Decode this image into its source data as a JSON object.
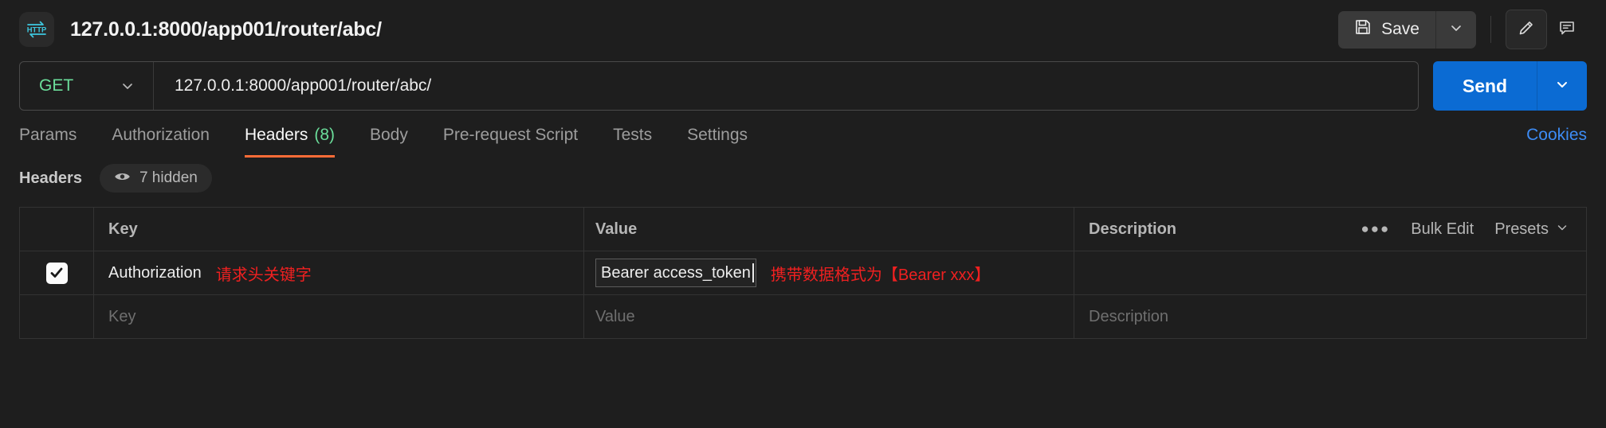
{
  "topbar": {
    "icon": "http-protocol-icon",
    "request_title": "127.0.0.1:8000/app001/router/abc/",
    "save_label": "Save",
    "save_icon": "floppy-disk-icon",
    "save_caret_icon": "chevron-down-icon",
    "edit_icon": "pencil-icon",
    "comment_icon": "comment-icon"
  },
  "url_row": {
    "method": "GET",
    "method_caret_icon": "chevron-down-icon",
    "url": "127.0.0.1:8000/app001/router/abc/",
    "send_label": "Send",
    "send_caret_icon": "chevron-down-icon"
  },
  "tabs": [
    {
      "label": "Params",
      "count": "",
      "active": false
    },
    {
      "label": "Authorization",
      "count": "",
      "active": false
    },
    {
      "label": "Headers",
      "count": "(8)",
      "active": true
    },
    {
      "label": "Body",
      "count": "",
      "active": false
    },
    {
      "label": "Pre-request Script",
      "count": "",
      "active": false
    },
    {
      "label": "Tests",
      "count": "",
      "active": false
    },
    {
      "label": "Settings",
      "count": "",
      "active": false
    }
  ],
  "cookies_label": "Cookies",
  "subbar": {
    "title": "Headers",
    "hidden_label": "7 hidden",
    "eye_icon": "eye-icon"
  },
  "table": {
    "columns": {
      "key": "Key",
      "value": "Value",
      "description": "Description"
    },
    "actions": {
      "more_icon": "ellipsis-icon",
      "bulk_edit": "Bulk Edit",
      "presets": "Presets",
      "presets_caret_icon": "chevron-down-icon"
    },
    "rows": [
      {
        "checked": true,
        "key": "Authorization",
        "key_note": "请求头关键字",
        "value": "Bearer access_token",
        "value_note": "携带数据格式为【Bearer xxx】",
        "description": ""
      }
    ],
    "placeholder_row": {
      "key": "Key",
      "value": "Value",
      "description": "Description"
    }
  },
  "colors": {
    "background": "#1e1e1e",
    "accent_orange": "#ff6c37",
    "send_blue": "#0b6bd3",
    "link_blue": "#3d8cf5",
    "method_green": "#6bdd9a",
    "note_red": "#ef2020",
    "icon_cyan": "#3ec8e0"
  }
}
